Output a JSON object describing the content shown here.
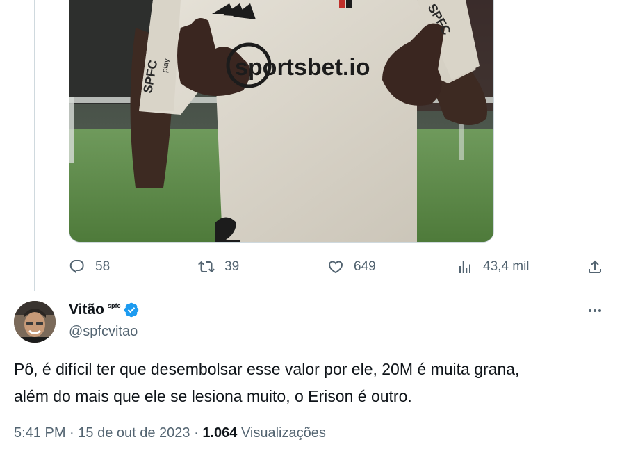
{
  "stats": {
    "replies": "58",
    "retweets": "39",
    "likes": "649",
    "views": "43,4 mil"
  },
  "media": {
    "shirt_sponsor": "sportsbet.io",
    "sleeve_badge": "SPFC",
    "sleeve_sub": "play"
  },
  "reply": {
    "display_name": "Vitão",
    "name_tag": "spfc",
    "handle": "@spfcvitao",
    "text_line1": "Pô, é difícil ter que desembolsar esse valor por ele, 20M é muita grana,",
    "text_line2": "além do mais que ele se lesiona muito, o Erison é outro.",
    "time": "5:41 PM",
    "sep1": " · ",
    "date": "15 de out de 2023",
    "sep2": " · ",
    "view_count": "1.064",
    "views_label": "Visualizações"
  },
  "colors": {
    "secondary_text": "#536471",
    "primary_text": "#0f1419",
    "verified": "#1d9bf0",
    "border": "#cfd9de"
  },
  "icons": {
    "reply": "reply-icon",
    "retweet": "retweet-icon",
    "like": "heart-icon",
    "views": "views-chart-icon",
    "share": "share-icon",
    "verified": "verified-badge-icon",
    "more": "more-icon"
  }
}
